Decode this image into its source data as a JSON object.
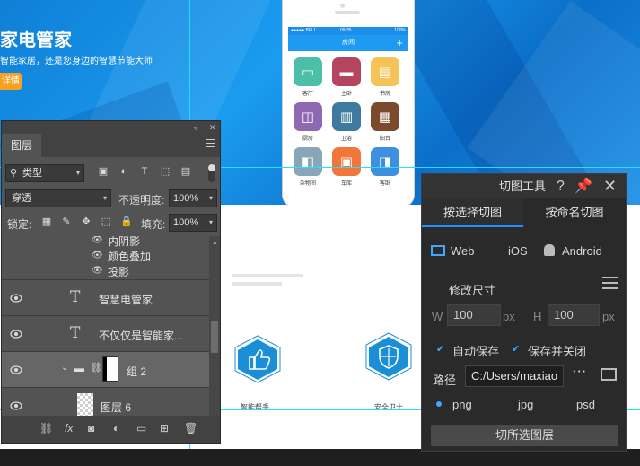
{
  "banner": {
    "title": "家电管家",
    "subtitle": "智能家居，还是您身边的智慧节能大师",
    "button_label": "详情"
  },
  "phone": {
    "status_left": "●●●●● BELL",
    "status_time": "09:35",
    "status_right": "100%",
    "nav_title": "房间",
    "nav_action": "+",
    "rooms": [
      {
        "label": "客厅",
        "color": "#4cbfa6"
      },
      {
        "label": "主卧",
        "color": "#b5455e"
      },
      {
        "label": "书房",
        "color": "#f6c358"
      },
      {
        "label": "厨房",
        "color": "#8f68b3"
      },
      {
        "label": "卫浴",
        "color": "#3d7a9e"
      },
      {
        "label": "阳台",
        "color": "#7a4a2a"
      },
      {
        "label": "杂物间",
        "color": "#88a6b8"
      },
      {
        "label": "车库",
        "color": "#f0763a"
      },
      {
        "label": "客卧",
        "color": "#3e8fe0"
      }
    ]
  },
  "page": {
    "hex_left_label": "智能帮手",
    "hex_right_label": "安全卫士"
  },
  "layers_panel": {
    "tab_label": "图层",
    "filter_kind": "类型",
    "blend_mode": "穿透",
    "opacity_label": "不透明度:",
    "opacity_value": "100%",
    "lock_label": "锁定:",
    "fill_label": "填充:",
    "fill_value": "100%",
    "effects": [
      "内阴影",
      "颜色叠加",
      "投影"
    ],
    "layers": [
      {
        "name": "智慧电管家",
        "kind": "text"
      },
      {
        "name": "不仅仅是智能家...",
        "kind": "text"
      },
      {
        "name": "组 2",
        "kind": "group"
      },
      {
        "name": "图层 6",
        "kind": "pixel"
      }
    ],
    "footer_fx": "fx"
  },
  "cutter": {
    "title": "切图工具",
    "tab_selected": "按选择切图",
    "tab_named": "按命名切图",
    "platforms": [
      "Web",
      "iOS",
      "Android"
    ],
    "resize_label": "修改尺寸",
    "w_label": "W",
    "w_value": "100",
    "h_label": "H",
    "h_value": "100",
    "unit": "px",
    "autosave_label": "自动保存",
    "save_close_label": "保存并关闭",
    "path_label": "路径",
    "path_value": "C:/Users/maxiao",
    "formats": [
      "png",
      "jpg",
      "psd"
    ],
    "action_label": "切所选图层",
    "accent": "#1e90ff"
  }
}
